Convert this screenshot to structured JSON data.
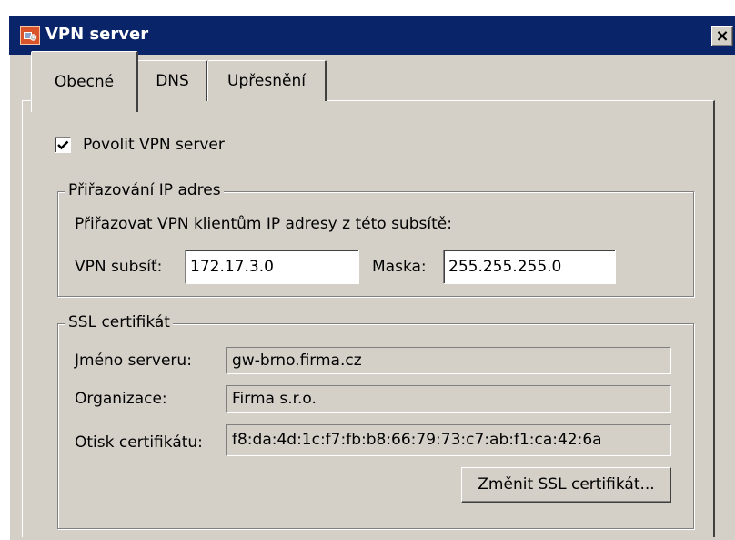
{
  "window": {
    "title": "VPN server",
    "close_label": "×"
  },
  "tabs": [
    {
      "label": "Obecné",
      "active": true
    },
    {
      "label": "DNS",
      "active": false
    },
    {
      "label": "Upřesnění",
      "active": false
    }
  ],
  "general": {
    "enable_vpn_label": "Povolit VPN server",
    "enable_vpn_checked": true
  },
  "ip_assignment": {
    "group_title": "Přiřazování IP adres",
    "description": "Přiřazovat VPN klientům IP adresy z této subsítě:",
    "subnet_label": "VPN subsíť:",
    "subnet_value": "172.17.3.0",
    "mask_label": "Maska:",
    "mask_value": "255.255.255.0"
  },
  "ssl": {
    "group_title": "SSL certifikát",
    "server_name_label": "Jméno serveru:",
    "server_name_value": "gw-brno.firma.cz",
    "organization_label": "Organizace:",
    "organization_value": "Firma s.r.o.",
    "fingerprint_label": "Otisk certifikátu:",
    "fingerprint_value": "f8:da:4d:1c:f7:fb:b8:66:79:73:c7:ab:f1:ca:42:6a",
    "change_button_label": "Změnit SSL certifikát..."
  },
  "colors": {
    "titlebar": "#0a246a",
    "dialog_face": "#d4d0c8",
    "title_icon": "#d9542b"
  }
}
